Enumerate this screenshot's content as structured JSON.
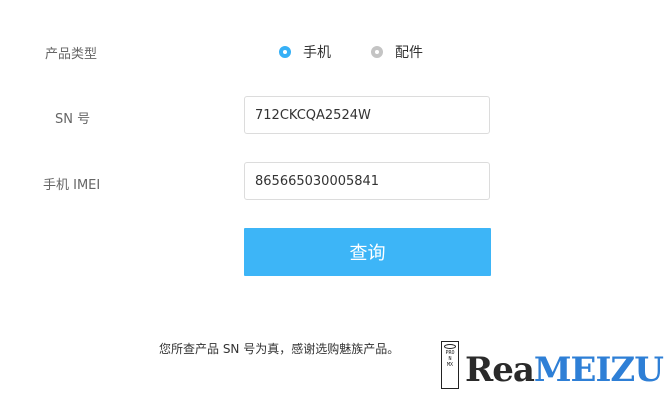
{
  "form": {
    "product_type_label": "产品类型",
    "product_options": [
      {
        "label": "手机",
        "selected": true
      },
      {
        "label": "配件",
        "selected": false
      }
    ],
    "sn_label": "SN 号",
    "sn_value": "712CKCQA2524W",
    "imei_label": "手机 IMEI",
    "imei_value": "865665030005841",
    "query_button": "查询"
  },
  "result_text": "您所查产品 SN 号为真，感谢选购魅族产品。",
  "stamp": {
    "lines": [
      "PRO",
      "N",
      "MX"
    ]
  },
  "watermark": {
    "part1": "Rea",
    "part2": "MEIZU"
  },
  "colors": {
    "accent": "#3db5f7",
    "watermark_blue": "#2e7fd6"
  }
}
